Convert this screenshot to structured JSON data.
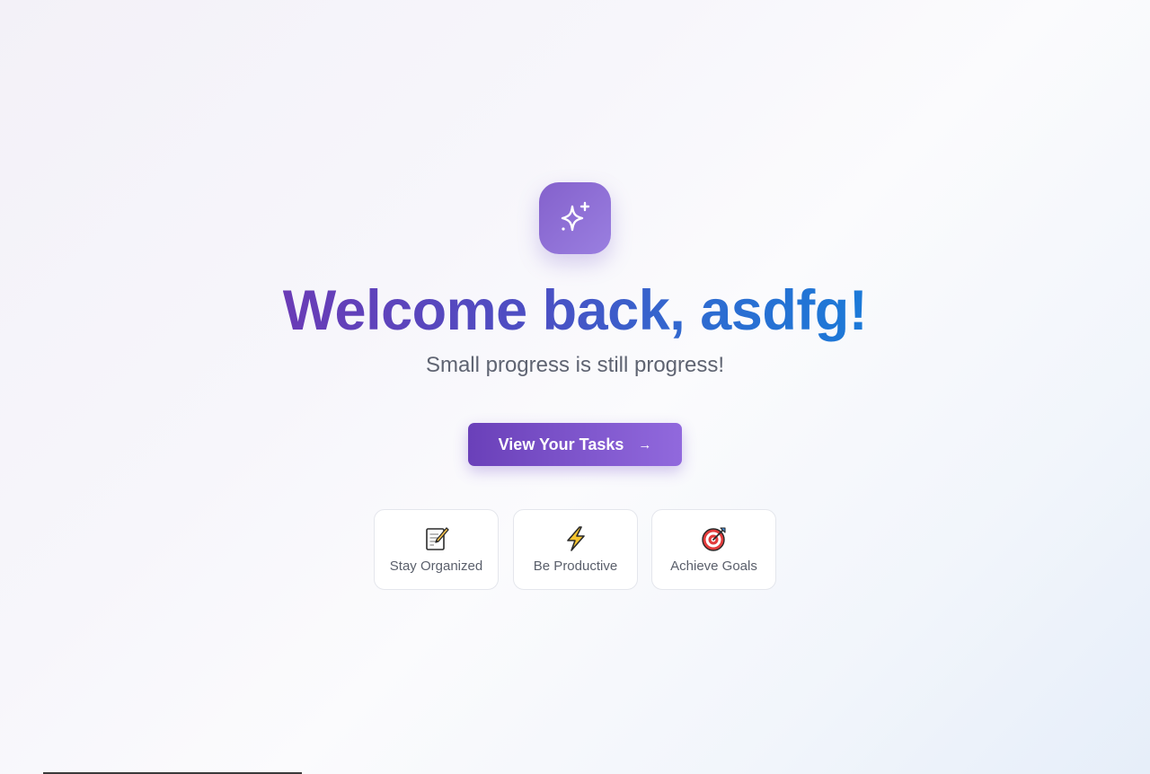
{
  "welcome": {
    "title": "Welcome back, asdfg!",
    "subtitle": "Small progress is still progress!"
  },
  "app_icon": {
    "name": "sparkles-icon"
  },
  "cta": {
    "label": "View Your Tasks",
    "arrow": "→",
    "icon": "arrow-right-icon"
  },
  "features": [
    {
      "label": "Stay Organized",
      "icon": "memo-icon"
    },
    {
      "label": "Be Productive",
      "icon": "lightning-icon"
    },
    {
      "label": "Achieve Goals",
      "icon": "target-icon"
    }
  ],
  "colors": {
    "accent_start": "#6a40b9",
    "accent_end": "#9169dd",
    "title_start": "#6a3bb6",
    "title_end": "#1b7ad8",
    "subtitle": "#5f6472"
  }
}
